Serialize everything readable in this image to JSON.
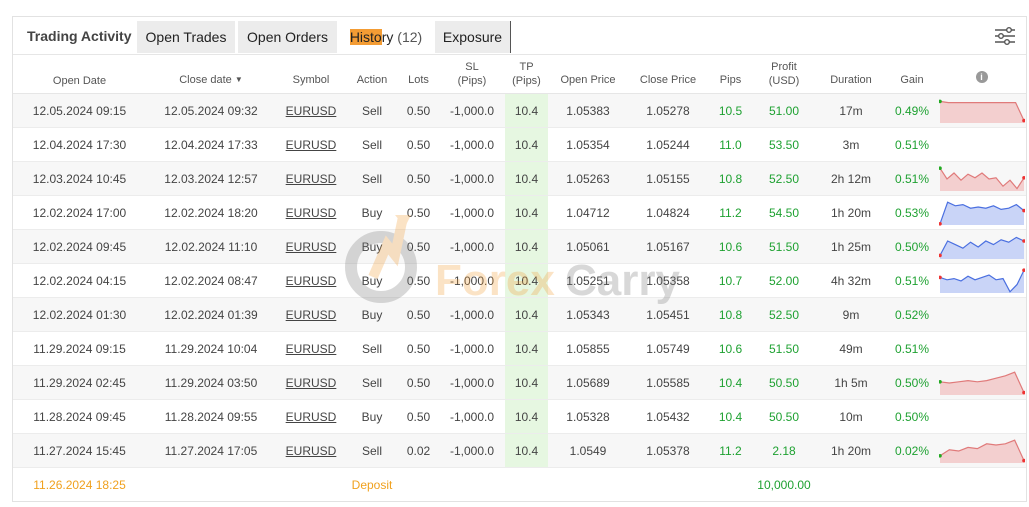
{
  "colors": {
    "accent": "#f39c34",
    "positive": "#1ea131",
    "deposit": "#f0a11e",
    "tp_bg": "#e6f7e1",
    "spark_red": "#e07a7a",
    "spark_blue": "#4a6fe0"
  },
  "tabs": {
    "title": "Trading Activity",
    "open_trades": "Open Trades",
    "open_orders": "Open Orders",
    "history_hl": "Histo",
    "history_rest": "ry",
    "history_count": "(12)",
    "exposure": "Exposure"
  },
  "headers": {
    "open_date": "Open Date",
    "close_date": "Close date",
    "symbol": "Symbol",
    "action": "Action",
    "lots": "Lots",
    "sl": "SL",
    "sl_unit": "(Pips)",
    "tp": "TP",
    "tp_unit": "(Pips)",
    "open_price": "Open Price",
    "close_price": "Close Price",
    "pips": "Pips",
    "profit": "Profit",
    "profit_unit": "(USD)",
    "duration": "Duration",
    "gain": "Gain"
  },
  "trades": [
    {
      "open_date": "12.05.2024 09:15",
      "close_date": "12.05.2024 09:32",
      "symbol": "EURUSD",
      "action": "Sell",
      "lots": "0.50",
      "sl": "-1,000.0",
      "tp": "10.4",
      "open_price": "1.05383",
      "close_price": "1.05278",
      "pips": "10.5",
      "profit": "51.00",
      "duration": "17m",
      "gain": "0.49%",
      "spark": "red",
      "spark_values": [
        0.9,
        0.85,
        0.85,
        0.85,
        0.85,
        0.85,
        0.85,
        0.85,
        0.85,
        0.85,
        0.1
      ]
    },
    {
      "open_date": "12.04.2024 17:30",
      "close_date": "12.04.2024 17:33",
      "symbol": "EURUSD",
      "action": "Sell",
      "lots": "0.50",
      "sl": "-1,000.0",
      "tp": "10.4",
      "open_price": "1.05354",
      "close_price": "1.05244",
      "pips": "11.0",
      "profit": "53.50",
      "duration": "3m",
      "gain": "0.51%",
      "spark": "none",
      "spark_values": []
    },
    {
      "open_date": "12.03.2024 10:45",
      "close_date": "12.03.2024 12:57",
      "symbol": "EURUSD",
      "action": "Sell",
      "lots": "0.50",
      "sl": "-1,000.0",
      "tp": "10.4",
      "open_price": "1.05263",
      "close_price": "1.05155",
      "pips": "10.8",
      "profit": "52.50",
      "duration": "2h 12m",
      "gain": "0.51%",
      "spark": "red",
      "spark_values": [
        0.95,
        0.5,
        0.75,
        0.45,
        0.7,
        0.55,
        0.75,
        0.5,
        0.55,
        0.2,
        0.45,
        0.1,
        0.55
      ]
    },
    {
      "open_date": "12.02.2024 17:00",
      "close_date": "12.02.2024 18:20",
      "symbol": "EURUSD",
      "action": "Buy",
      "lots": "0.50",
      "sl": "-1,000.0",
      "tp": "10.4",
      "open_price": "1.04712",
      "close_price": "1.04824",
      "pips": "11.2",
      "profit": "54.50",
      "duration": "1h 20m",
      "gain": "0.53%",
      "spark": "blue",
      "spark_values": [
        0.05,
        0.95,
        0.8,
        0.85,
        0.7,
        0.75,
        0.7,
        0.8,
        0.65,
        0.7,
        0.85,
        0.6
      ]
    },
    {
      "open_date": "12.02.2024 09:45",
      "close_date": "12.02.2024 11:10",
      "symbol": "EURUSD",
      "action": "Buy",
      "lots": "0.50",
      "sl": "-1,000.0",
      "tp": "10.4",
      "open_price": "1.05061",
      "close_price": "1.05167",
      "pips": "10.6",
      "profit": "51.50",
      "duration": "1h 25m",
      "gain": "0.50%",
      "spark": "blue",
      "spark_values": [
        0.15,
        0.75,
        0.6,
        0.45,
        0.7,
        0.5,
        0.75,
        0.6,
        0.8,
        0.7,
        0.9,
        0.75
      ]
    },
    {
      "open_date": "12.02.2024 04:15",
      "close_date": "12.02.2024 08:47",
      "symbol": "EURUSD",
      "action": "Buy",
      "lots": "0.50",
      "sl": "-1,000.0",
      "tp": "10.4",
      "open_price": "1.05251",
      "close_price": "1.05358",
      "pips": "10.7",
      "profit": "52.00",
      "duration": "4h 32m",
      "gain": "0.51%",
      "spark": "blue",
      "spark_values": [
        0.65,
        0.55,
        0.6,
        0.5,
        0.7,
        0.55,
        0.65,
        0.75,
        0.55,
        0.6,
        0.05,
        0.35,
        0.95
      ]
    },
    {
      "open_date": "12.02.2024 01:30",
      "close_date": "12.02.2024 01:39",
      "symbol": "EURUSD",
      "action": "Buy",
      "lots": "0.50",
      "sl": "-1,000.0",
      "tp": "10.4",
      "open_price": "1.05343",
      "close_price": "1.05451",
      "pips": "10.8",
      "profit": "52.50",
      "duration": "9m",
      "gain": "0.52%",
      "spark": "none",
      "spark_values": []
    },
    {
      "open_date": "11.29.2024 09:15",
      "close_date": "11.29.2024 10:04",
      "symbol": "EURUSD",
      "action": "Sell",
      "lots": "0.50",
      "sl": "-1,000.0",
      "tp": "10.4",
      "open_price": "1.05855",
      "close_price": "1.05749",
      "pips": "10.6",
      "profit": "51.50",
      "duration": "49m",
      "gain": "0.51%",
      "spark": "none",
      "spark_values": []
    },
    {
      "open_date": "11.29.2024 02:45",
      "close_date": "11.29.2024 03:50",
      "symbol": "EURUSD",
      "action": "Sell",
      "lots": "0.50",
      "sl": "-1,000.0",
      "tp": "10.4",
      "open_price": "1.05689",
      "close_price": "1.05585",
      "pips": "10.4",
      "profit": "50.50",
      "duration": "1h 5m",
      "gain": "0.50%",
      "spark": "red",
      "spark_values": [
        0.55,
        0.5,
        0.55,
        0.6,
        0.55,
        0.6,
        0.7,
        0.8,
        0.95,
        0.1
      ]
    },
    {
      "open_date": "11.28.2024 09:45",
      "close_date": "11.28.2024 09:55",
      "symbol": "EURUSD",
      "action": "Buy",
      "lots": "0.50",
      "sl": "-1,000.0",
      "tp": "10.4",
      "open_price": "1.05328",
      "close_price": "1.05432",
      "pips": "10.4",
      "profit": "50.50",
      "duration": "10m",
      "gain": "0.50%",
      "spark": "none",
      "spark_values": []
    },
    {
      "open_date": "11.27.2024 15:45",
      "close_date": "11.27.2024 17:05",
      "symbol": "EURUSD",
      "action": "Sell",
      "lots": "0.02",
      "sl": "-1,000.0",
      "tp": "10.4",
      "open_price": "1.0549",
      "close_price": "1.05378",
      "pips": "11.2",
      "profit": "2.18",
      "duration": "1h 20m",
      "gain": "0.02%",
      "spark": "red",
      "spark_values": [
        0.3,
        0.55,
        0.5,
        0.65,
        0.6,
        0.8,
        0.75,
        0.8,
        0.95,
        0.1
      ]
    }
  ],
  "deposit": {
    "date": "11.26.2024 18:25",
    "label": "Deposit",
    "amount": "10,000.00"
  },
  "watermark": {
    "text_orange": "Forex",
    "text_gray": "Carry"
  }
}
